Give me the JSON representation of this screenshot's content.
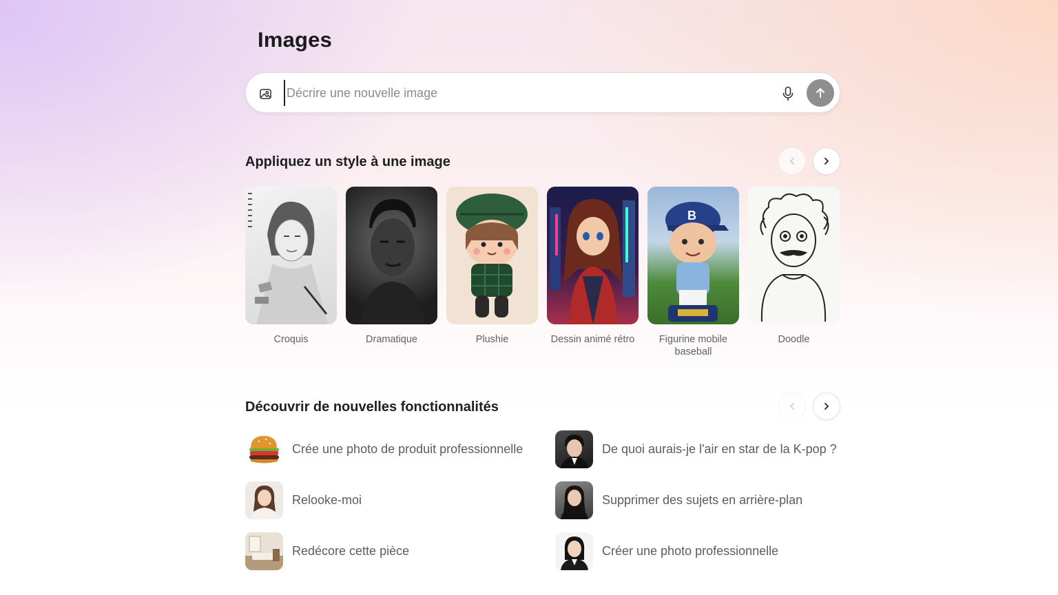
{
  "page": {
    "title": "Images"
  },
  "search": {
    "placeholder": "Décrire une nouvelle image",
    "value": "",
    "image_icon": "image-upload-icon",
    "mic_icon": "microphone-icon",
    "send_icon": "arrow-up-icon"
  },
  "styles": {
    "title": "Appliquez un style à une image",
    "items": [
      {
        "label": "Croquis"
      },
      {
        "label": "Dramatique"
      },
      {
        "label": "Plushie"
      },
      {
        "label": "Dessin animé rétro"
      },
      {
        "label": "Figurine mobile baseball"
      },
      {
        "label": "Doodle"
      }
    ]
  },
  "features": {
    "title": "Découvrir de nouvelles fonctionnalités",
    "items": [
      {
        "label": "Crée une photo de produit professionnelle"
      },
      {
        "label": "De quoi aurais-je l'air en star de la K-pop ?"
      },
      {
        "label": "Relooke-moi"
      },
      {
        "label": "Supprimer des sujets en arrière-plan"
      },
      {
        "label": "Redécore cette pièce"
      },
      {
        "label": "Créer une photo professionnelle"
      }
    ]
  },
  "colors": {
    "send_button": "#8e8e8e",
    "accent_text": "#1f1f1f",
    "muted_text": "#616161"
  }
}
